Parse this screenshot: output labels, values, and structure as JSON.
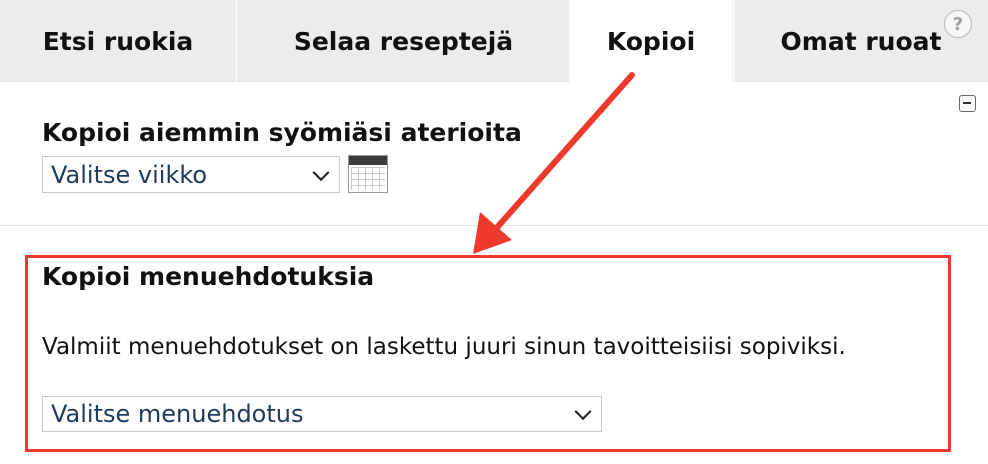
{
  "tabs": [
    {
      "label": "Etsi ruokia",
      "active": false
    },
    {
      "label": "Selaa reseptejä",
      "active": false
    },
    {
      "label": "Kopioi",
      "active": true
    },
    {
      "label": "Omat ruoat",
      "active": false
    }
  ],
  "help": {
    "glyph": "?"
  },
  "copy_meals": {
    "heading": "Kopioi aiemmin syömiäsi aterioita",
    "week_select": "Valitse viikko"
  },
  "menu_suggestions": {
    "heading": "Kopioi menuehdotuksia",
    "description": "Valmiit menuehdotukset on laskettu juuri sinun tavoitteisiisi sopiviksi.",
    "menu_select": "Valitse menuehdotus"
  },
  "colors": {
    "accent_annotation": "#ee3a2c",
    "tab_bar": "#ececec",
    "select_text": "#1f3a5c"
  },
  "icons": [
    "help-icon",
    "collapse-icon",
    "calendar-icon",
    "chevron-down-icon",
    "annotation-arrow"
  ]
}
